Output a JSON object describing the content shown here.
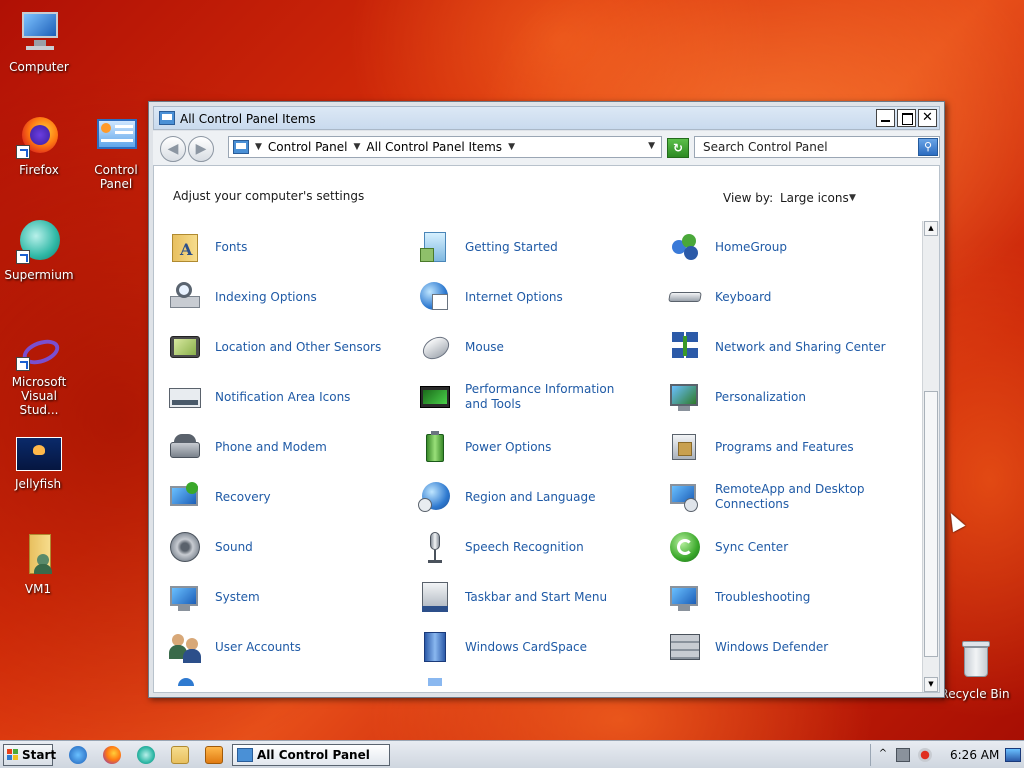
{
  "desktop": {
    "icons": [
      {
        "label": "Computer",
        "icon": "computer-icon"
      },
      {
        "label": "Firefox",
        "icon": "firefox-icon"
      },
      {
        "label": "Control Panel",
        "icon": "control-panel-icon"
      },
      {
        "label": "Supermium",
        "icon": "supermium-icon"
      },
      {
        "label": "Microsoft Visual Stud...",
        "icon": "visual-studio-icon"
      },
      {
        "label": "Jellyfish",
        "icon": "jellyfish-image-icon"
      },
      {
        "label": "VM1",
        "icon": "user-folder-icon"
      },
      {
        "label": "Recycle Bin",
        "icon": "recycle-bin-icon"
      }
    ]
  },
  "window": {
    "title": "All Control Panel Items",
    "address": {
      "crumbs": [
        "Control Panel",
        "All Control Panel Items"
      ]
    },
    "search_placeholder": "Search Control Panel",
    "heading": "Adjust your computer's settings",
    "view_by_label": "View by:",
    "view_by_value": "Large icons",
    "items": [
      {
        "label": "Fonts",
        "icon": "fonts-icon"
      },
      {
        "label": "Getting Started",
        "icon": "getting-started-icon"
      },
      {
        "label": "HomeGroup",
        "icon": "homegroup-icon"
      },
      {
        "label": "Indexing Options",
        "icon": "indexing-options-icon"
      },
      {
        "label": "Internet Options",
        "icon": "internet-options-icon"
      },
      {
        "label": "Keyboard",
        "icon": "keyboard-icon"
      },
      {
        "label": "Location and Other Sensors",
        "icon": "location-sensors-icon"
      },
      {
        "label": "Mouse",
        "icon": "mouse-icon"
      },
      {
        "label": "Network and Sharing Center",
        "icon": "network-icon"
      },
      {
        "label": "Notification Area Icons",
        "icon": "notification-area-icon"
      },
      {
        "label": "Performance Information and Tools",
        "icon": "performance-icon"
      },
      {
        "label": "Personalization",
        "icon": "personalization-icon"
      },
      {
        "label": "Phone and Modem",
        "icon": "phone-icon"
      },
      {
        "label": "Power Options",
        "icon": "power-options-icon"
      },
      {
        "label": "Programs and Features",
        "icon": "programs-features-icon"
      },
      {
        "label": "Recovery",
        "icon": "recovery-icon"
      },
      {
        "label": "Region and Language",
        "icon": "region-language-icon"
      },
      {
        "label": "RemoteApp and Desktop Connections",
        "icon": "remoteapp-icon"
      },
      {
        "label": "Sound",
        "icon": "sound-icon"
      },
      {
        "label": "Speech Recognition",
        "icon": "microphone-icon"
      },
      {
        "label": "Sync Center",
        "icon": "sync-center-icon"
      },
      {
        "label": "System",
        "icon": "system-icon"
      },
      {
        "label": "Taskbar and Start Menu",
        "icon": "taskbar-icon"
      },
      {
        "label": "Troubleshooting",
        "icon": "troubleshooting-icon"
      },
      {
        "label": "User Accounts",
        "icon": "user-accounts-icon"
      },
      {
        "label": "Windows CardSpace",
        "icon": "cardspace-icon"
      },
      {
        "label": "Windows Defender",
        "icon": "defender-icon"
      }
    ]
  },
  "taskbar": {
    "start_label": "Start",
    "active_task": "All Control Panel Items",
    "clock": "6:26 AM"
  }
}
